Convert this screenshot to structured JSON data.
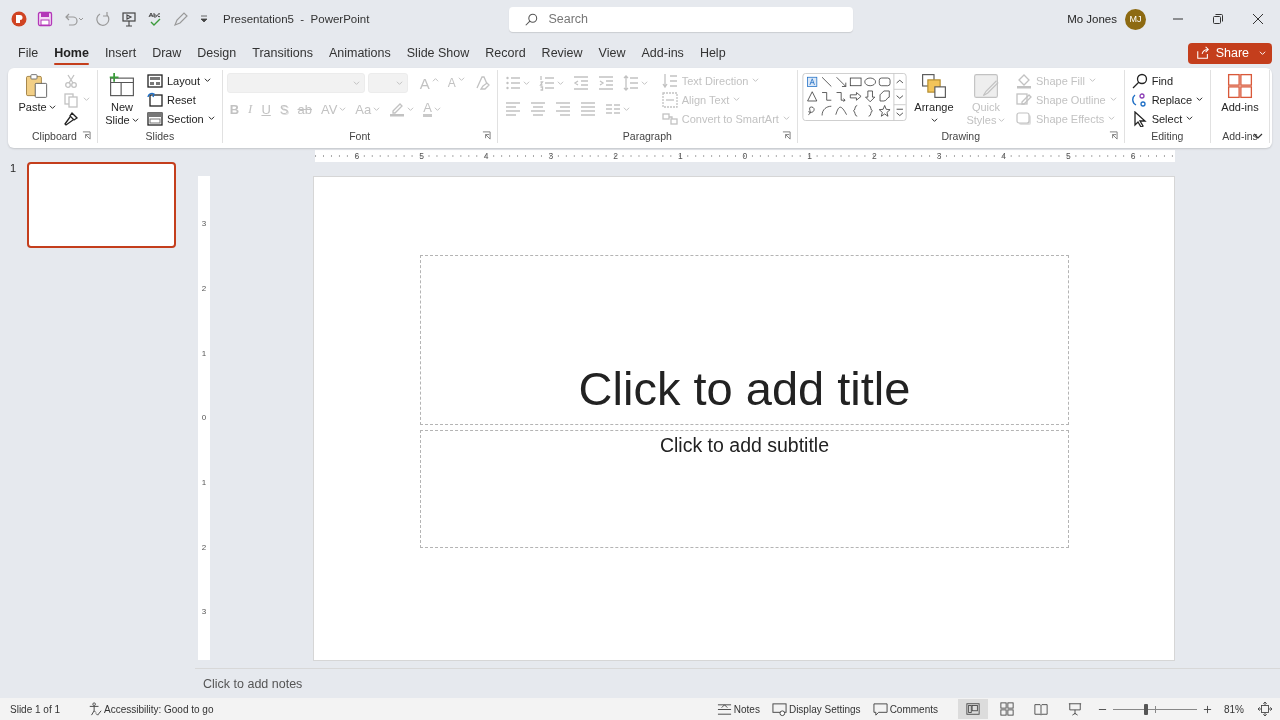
{
  "title_bar": {
    "title": "Presentation5  -  PowerPoint",
    "search": {
      "placeholder": "Search"
    },
    "user": {
      "name": "Mo Jones",
      "initials": "MJ"
    }
  },
  "tabs": [
    {
      "label": "File",
      "selected": false
    },
    {
      "label": "Home",
      "selected": true
    },
    {
      "label": "Insert",
      "selected": false
    },
    {
      "label": "Draw",
      "selected": false
    },
    {
      "label": "Design",
      "selected": false
    },
    {
      "label": "Transitions",
      "selected": false
    },
    {
      "label": "Animations",
      "selected": false
    },
    {
      "label": "Slide Show",
      "selected": false
    },
    {
      "label": "Record",
      "selected": false
    },
    {
      "label": "Review",
      "selected": false
    },
    {
      "label": "View",
      "selected": false
    },
    {
      "label": "Add-ins",
      "selected": false
    },
    {
      "label": "Help",
      "selected": false
    }
  ],
  "share": {
    "label": "Share"
  },
  "ribbon": {
    "groups": [
      {
        "label": "Clipboard",
        "launcher": true,
        "sections": [
          {
            "kind": "large",
            "items": [
              {
                "label": "Paste",
                "dropdown": true,
                "disabled": false
              }
            ]
          },
          {
            "kind": "stack",
            "items": [
              {
                "dropdown": false,
                "disabled": true
              },
              {
                "dropdown": true,
                "disabled": true
              },
              {
                "dropdown": false,
                "disabled": false
              }
            ]
          }
        ]
      },
      {
        "label": "Slides",
        "launcher": false,
        "sections": [
          {
            "kind": "large",
            "items": [
              {
                "label": "New Slide",
                "dropdown": true,
                "disabled": false
              }
            ]
          },
          {
            "kind": "stack",
            "items": [
              {
                "label": "Layout",
                "dropdown": true,
                "disabled": false
              },
              {
                "label": "Reset",
                "dropdown": false,
                "disabled": false
              },
              {
                "label": "Section",
                "dropdown": true,
                "disabled": false
              }
            ]
          }
        ]
      },
      {
        "label": "Font",
        "launcher": true,
        "sections": [
          {
            "kind": "row",
            "items": [
              {
                "kind": "combo",
                "dropdown": true,
                "disabled": true
              },
              {
                "kind": "combo",
                "dropdown": true,
                "disabled": true
              },
              {
                "kind": "glyph",
                "text": "A",
                "dropdown": false,
                "disabled": true
              },
              {
                "kind": "glyph",
                "text": "A",
                "dropdown": false,
                "disabled": true
              },
              {
                "kind": "icon",
                "dropdown": false,
                "disabled": true
              }
            ]
          },
          {
            "kind": "row",
            "items": [
              {
                "kind": "glyph",
                "text": "B",
                "dropdown": false,
                "disabled": true
              },
              {
                "kind": "glyph",
                "text": "I",
                "dropdown": false,
                "disabled": true
              },
              {
                "kind": "glyph",
                "text": "U",
                "dropdown": false,
                "disabled": true
              },
              {
                "kind": "glyph",
                "text": "S",
                "dropdown": false,
                "disabled": true
              },
              {
                "kind": "glyph",
                "text": "ab",
                "dropdown": false,
                "disabled": true
              },
              {
                "kind": "glyph",
                "text": "AV",
                "dropdown": true,
                "disabled": true
              },
              {
                "kind": "glyph",
                "text": "Aa",
                "dropdown": true,
                "disabled": true
              },
              {
                "kind": "icon",
                "dropdown": true,
                "disabled": true
              },
              {
                "kind": "glyph",
                "text": "A",
                "dropdown": true,
                "disabled": true
              }
            ]
          }
        ]
      },
      {
        "label": "Paragraph",
        "launcher": true,
        "sections": [
          {
            "kind": "row",
            "items": [
              {
                "kind": "icon",
                "dropdown": true,
                "disabled": true
              },
              {
                "kind": "icon",
                "dropdown": true,
                "disabled": true
              },
              {
                "kind": "icon",
                "dropdown": false,
                "disabled": true
              },
              {
                "kind": "icon",
                "dropdown": false,
                "disabled": true
              },
              {
                "kind": "icon",
                "dropdown": true,
                "disabled": true
              }
            ]
          },
          {
            "kind": "row",
            "items": [
              {
                "kind": "icon",
                "dropdown": false,
                "disabled": true
              },
              {
                "kind": "icon",
                "dropdown": false,
                "disabled": true
              },
              {
                "kind": "icon",
                "dropdown": false,
                "disabled": true
              },
              {
                "kind": "icon",
                "dropdown": false,
                "disabled": true
              },
              {
                "kind": "icon",
                "dropdown": true,
                "disabled": true
              }
            ]
          },
          {
            "kind": "stack",
            "items": [
              {
                "label": "Text Direction",
                "dropdown": true,
                "disabled": true
              },
              {
                "label": "Align Text",
                "dropdown": true,
                "disabled": true
              },
              {
                "label": "Convert to SmartArt",
                "dropdown": true,
                "disabled": true
              }
            ]
          }
        ]
      },
      {
        "label": "Drawing",
        "launcher": true,
        "sections": [
          {
            "kind": "gallery"
          },
          {
            "kind": "large",
            "items": [
              {
                "label": "Arrange",
                "dropdown": true,
                "disabled": false
              },
              {
                "label": "Quick Styles",
                "dropdown": true,
                "disabled": true
              }
            ]
          },
          {
            "kind": "stack",
            "items": [
              {
                "label": "Shape Fill",
                "dropdown": true,
                "disabled": true
              },
              {
                "label": "Shape Outline",
                "dropdown": true,
                "disabled": true
              },
              {
                "label": "Shape Effects",
                "dropdown": true,
                "disabled": true
              }
            ]
          }
        ]
      },
      {
        "label": "Editing",
        "launcher": false,
        "sections": [
          {
            "kind": "stack",
            "items": [
              {
                "label": "Find",
                "dropdown": false,
                "disabled": false
              },
              {
                "label": "Replace",
                "dropdown": true,
                "disabled": false
              },
              {
                "label": "Select",
                "dropdown": true,
                "disabled": false
              }
            ]
          }
        ]
      },
      {
        "label": "Add-ins",
        "launcher": false,
        "sections": [
          {
            "kind": "large",
            "items": [
              {
                "label": "Add-ins",
                "dropdown": false,
                "disabled": false
              }
            ]
          }
        ]
      }
    ]
  },
  "slides_panel": {
    "slides": [
      {
        "number": "1",
        "selected": true
      }
    ]
  },
  "rulers": {
    "horizontal": [
      "6",
      "5",
      "4",
      "3",
      "2",
      "1",
      "0",
      "1",
      "2",
      "3",
      "4",
      "5",
      "6"
    ],
    "vertical": [
      "3",
      "2",
      "1",
      "0",
      "1",
      "2",
      "3"
    ]
  },
  "slide": {
    "title_placeholder": "Click to add title",
    "subtitle_placeholder": "Click to add subtitle"
  },
  "notes": {
    "placeholder": "Click to add notes"
  },
  "status_bar": {
    "slide_position": "Slide 1 of 1",
    "accessibility": "Accessibility: Good to go",
    "buttons": [
      {
        "label": "Notes"
      },
      {
        "label": "Display Settings"
      },
      {
        "label": "Comments"
      }
    ],
    "views": [
      {
        "selected": true
      },
      {
        "selected": false
      },
      {
        "selected": false
      },
      {
        "selected": false
      }
    ],
    "zoom": {
      "level": 0.39,
      "reading": "81%"
    }
  }
}
